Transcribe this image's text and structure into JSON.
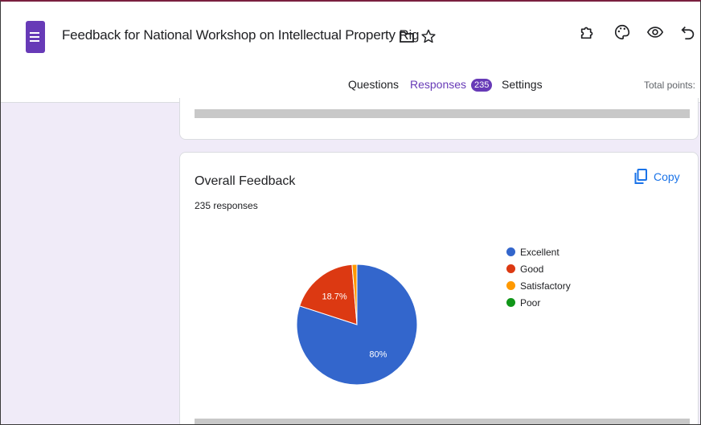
{
  "header": {
    "form_title": "Feedback  for National Workshop on Intellectual Property Rig",
    "folder_icon": "folder-icon",
    "star_icon": "star-icon",
    "right_icons": [
      "puzzle-addon-icon",
      "palette-icon",
      "eye-preview-icon",
      "undo-icon"
    ]
  },
  "tabs": [
    {
      "label": "Questions"
    },
    {
      "label": "Responses",
      "badge": "235",
      "active": true
    },
    {
      "label": "Settings"
    }
  ],
  "total_points_label": "Total points:",
  "question": {
    "title": "Overall Feedback",
    "response_count": "235 responses",
    "copy_label": "Copy"
  },
  "chart_data": {
    "type": "pie",
    "categories": [
      "Excellent",
      "Good",
      "Satisfactory",
      "Poor"
    ],
    "values": [
      80,
      18.7,
      1.3,
      0
    ],
    "slice_labels": [
      "80%",
      "18.7%",
      "",
      ""
    ],
    "colors": [
      "#3366cc",
      "#dc3912",
      "#ff9900",
      "#109618"
    ],
    "legend_position": "right"
  },
  "colors": {
    "brand": "#673ab7",
    "link": "#1a73e8",
    "background": "#f0ebf8"
  }
}
